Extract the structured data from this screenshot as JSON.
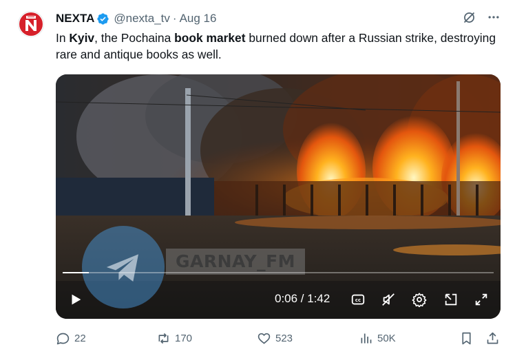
{
  "tweet": {
    "author_name": "NEXTA",
    "handle": "@nexta_tv",
    "separator": "·",
    "date": "Aug 16",
    "text": {
      "p1": "In ",
      "b1": "Kyiv",
      "p2": ", the Pochaina ",
      "b2": "book market",
      "p3": " burned down after a Russian strike, destroying rare and antique books as well."
    }
  },
  "video": {
    "watermark": "GARNAY_FM",
    "time_display": "0:06 / 1:42",
    "progress_fraction": 0.06,
    "muted": true
  },
  "actions": {
    "replies": "22",
    "reposts": "170",
    "likes": "523",
    "views": "50K"
  },
  "colors": {
    "verified_badge": "#1d9bf0",
    "secondary_text": "#536471",
    "avatar_brand": "#d6202a"
  },
  "icons": {
    "verified": "verified-badge-icon",
    "grok": "grok-icon",
    "more": "more-icon",
    "play": "play-icon",
    "captions": "captions-icon",
    "mute": "muted-speaker-icon",
    "settings": "gear-icon",
    "popout": "popout-icon",
    "fullscreen": "fullscreen-icon",
    "reply": "reply-icon",
    "repost": "repost-icon",
    "like": "heart-icon",
    "views": "views-icon",
    "bookmark": "bookmark-icon",
    "share": "share-icon"
  }
}
